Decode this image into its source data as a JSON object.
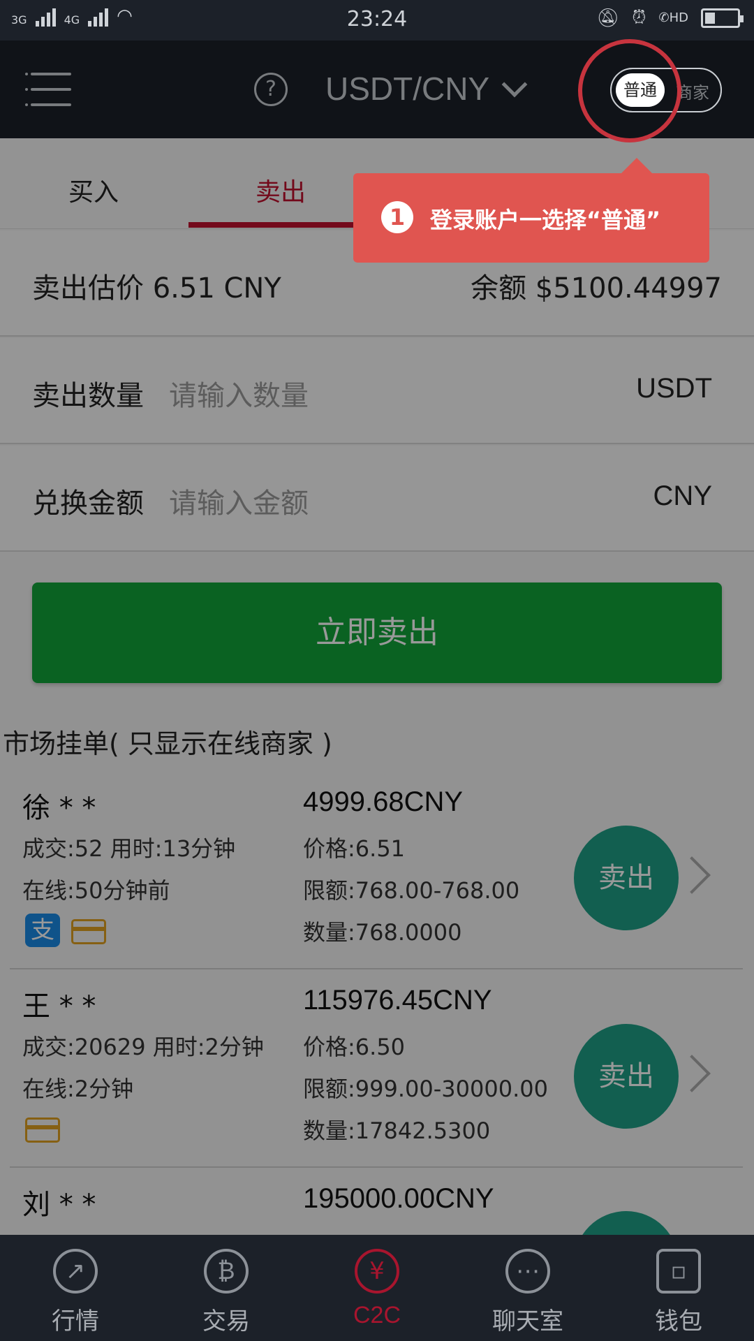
{
  "status_bar": {
    "net1": "3G",
    "net2": "4G",
    "time": "23:24",
    "hd": "HD"
  },
  "header": {
    "pair": "USDT/CNY",
    "help": "?",
    "toggle_on": "普通",
    "toggle_off": "商家"
  },
  "tabs": [
    "买入",
    "卖出",
    "",
    ""
  ],
  "summary": {
    "label": "卖出估价 6.51 CNY",
    "balance": "余额 $5100.44997"
  },
  "quantity": {
    "label": "卖出数量",
    "placeholder": "请输入数量",
    "unit": "USDT"
  },
  "amount": {
    "label": "兑换金额",
    "placeholder": "请输入金额",
    "unit": "CNY"
  },
  "sell_button": "立即卖出",
  "market_title": "市场挂单( 只显示在线商家 )",
  "listings": [
    {
      "name": "徐 * *",
      "deals": "成交:52  用时:13分钟",
      "online": "在线:50分钟前",
      "amount": "4999.68CNY",
      "price": "价格:6.51",
      "limit": "限额:768.00-768.00",
      "qty": "数量:768.0000",
      "btn": "卖出"
    },
    {
      "name": "王 * *",
      "deals": "成交:20629  用时:2分钟",
      "online": "在线:2分钟",
      "amount": "115976.45CNY",
      "price": "价格:6.50",
      "limit": "限额:999.00-30000.00",
      "qty": "数量:17842.5300",
      "btn": "卖出"
    },
    {
      "name": "刘 * *",
      "amount": "195000.00CNY"
    }
  ],
  "bottom_nav": [
    {
      "label": "行情",
      "icon": "chart-icon"
    },
    {
      "label": "交易",
      "icon": "bitcoin-icon"
    },
    {
      "label": "C2C",
      "icon": "c2c-icon"
    },
    {
      "label": "聊天室",
      "icon": "chat-icon"
    },
    {
      "label": "钱包",
      "icon": "wallet-icon"
    }
  ],
  "tooltip": {
    "step": "1",
    "text": "登录账户一选择“普通”"
  },
  "colors": {
    "accent": "#c0102e",
    "sell_green": "#11a33a",
    "tooltip": "#e05550",
    "nav_bg": "#1c2129"
  }
}
